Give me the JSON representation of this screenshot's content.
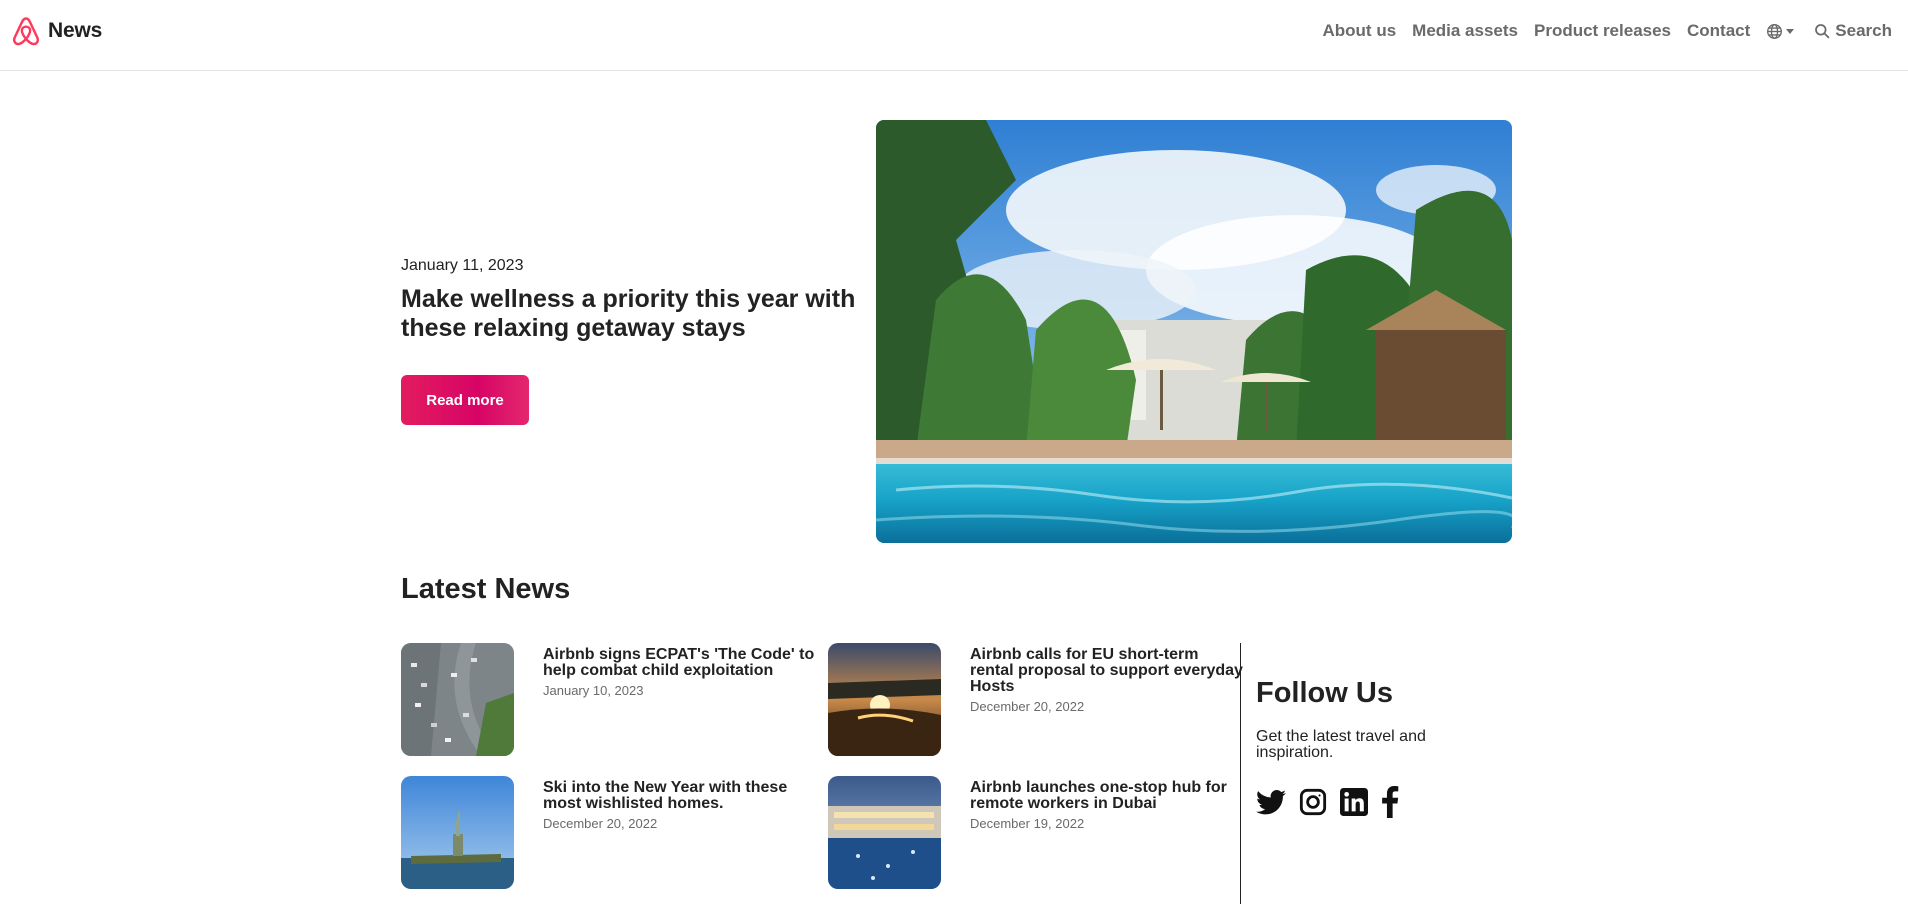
{
  "header": {
    "brand_name": "News",
    "nav": [
      "About us",
      "Media assets",
      "Product releases",
      "Contact"
    ],
    "search_label": "Search"
  },
  "hero": {
    "date": "January 11, 2023",
    "title": "Make wellness a priority this year with these relaxing getaway stays",
    "button_label": "Read more"
  },
  "latest": {
    "heading": "Latest News",
    "articles": [
      {
        "title": "Airbnb signs ECPAT's 'The Code' to help combat child exploitation",
        "date": "January 10, 2023"
      },
      {
        "title": "Airbnb calls for EU short-term rental proposal to support everyday Hosts",
        "date": "December 20, 2022"
      },
      {
        "title": "Ski into the New Year with these most wishlisted homes.",
        "date": "December 20, 2022"
      },
      {
        "title": "Airbnb launches one-stop hub for remote workers in Dubai",
        "date": "December 19, 2022"
      }
    ]
  },
  "follow": {
    "heading": "Follow Us",
    "text": "Get the latest travel and inspiration.",
    "icons": [
      "twitter-icon",
      "instagram-icon",
      "linkedin-icon",
      "facebook-icon"
    ]
  },
  "colors": {
    "brand": "#FF385C",
    "button": "#E31C5F",
    "text": "#222222",
    "muted": "#6A6A6A"
  }
}
